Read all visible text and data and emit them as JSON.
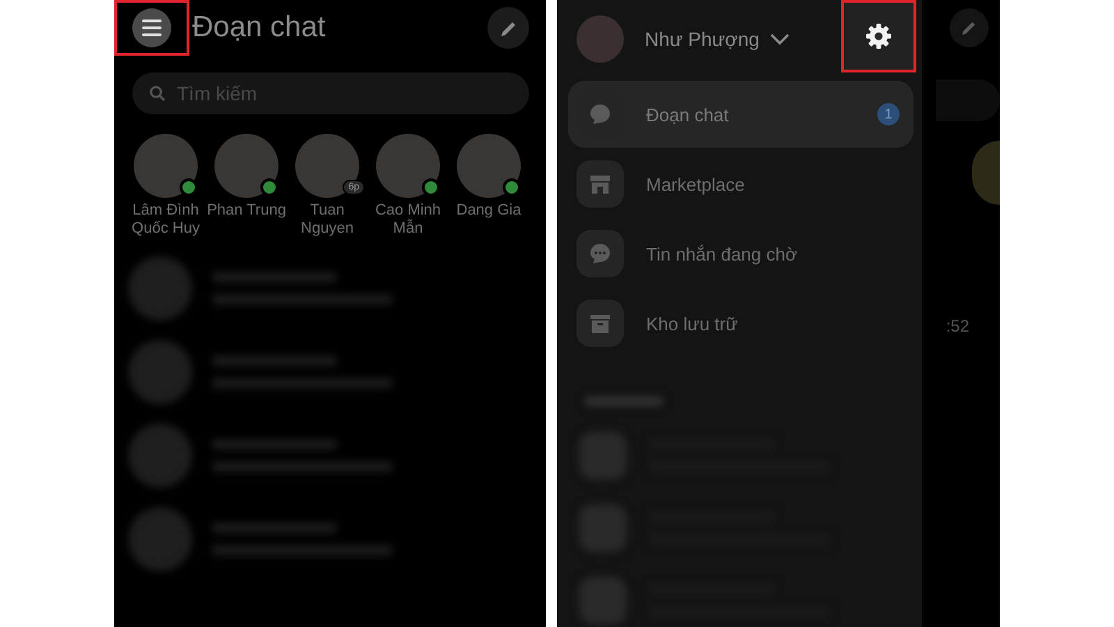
{
  "left_screen": {
    "menu_button": {
      "highlighted": true
    },
    "title": "Đoạn chat",
    "search": {
      "placeholder": "Tìm kiếm"
    },
    "stories": [
      {
        "name": "Lâm Đình Quốc Huy",
        "online": true
      },
      {
        "name": "Phan Trung",
        "online": true
      },
      {
        "name": "Tuan Nguyen",
        "online": false,
        "badge": "6p"
      },
      {
        "name": "Cao Minh Mẫn",
        "online": true
      },
      {
        "name": "Dang Gia",
        "online": true
      }
    ]
  },
  "right_screen": {
    "profile": {
      "name": "Như Phượng"
    },
    "settings_button": {
      "highlighted": true
    },
    "menu": [
      {
        "label": "Đoạn chat",
        "selected": true,
        "badge": "1"
      },
      {
        "label": "Marketplace",
        "selected": false
      },
      {
        "label": "Tin nhắn đang chờ",
        "selected": false
      },
      {
        "label": "Kho lưu trữ",
        "selected": false
      }
    ],
    "background_time": ":52"
  }
}
